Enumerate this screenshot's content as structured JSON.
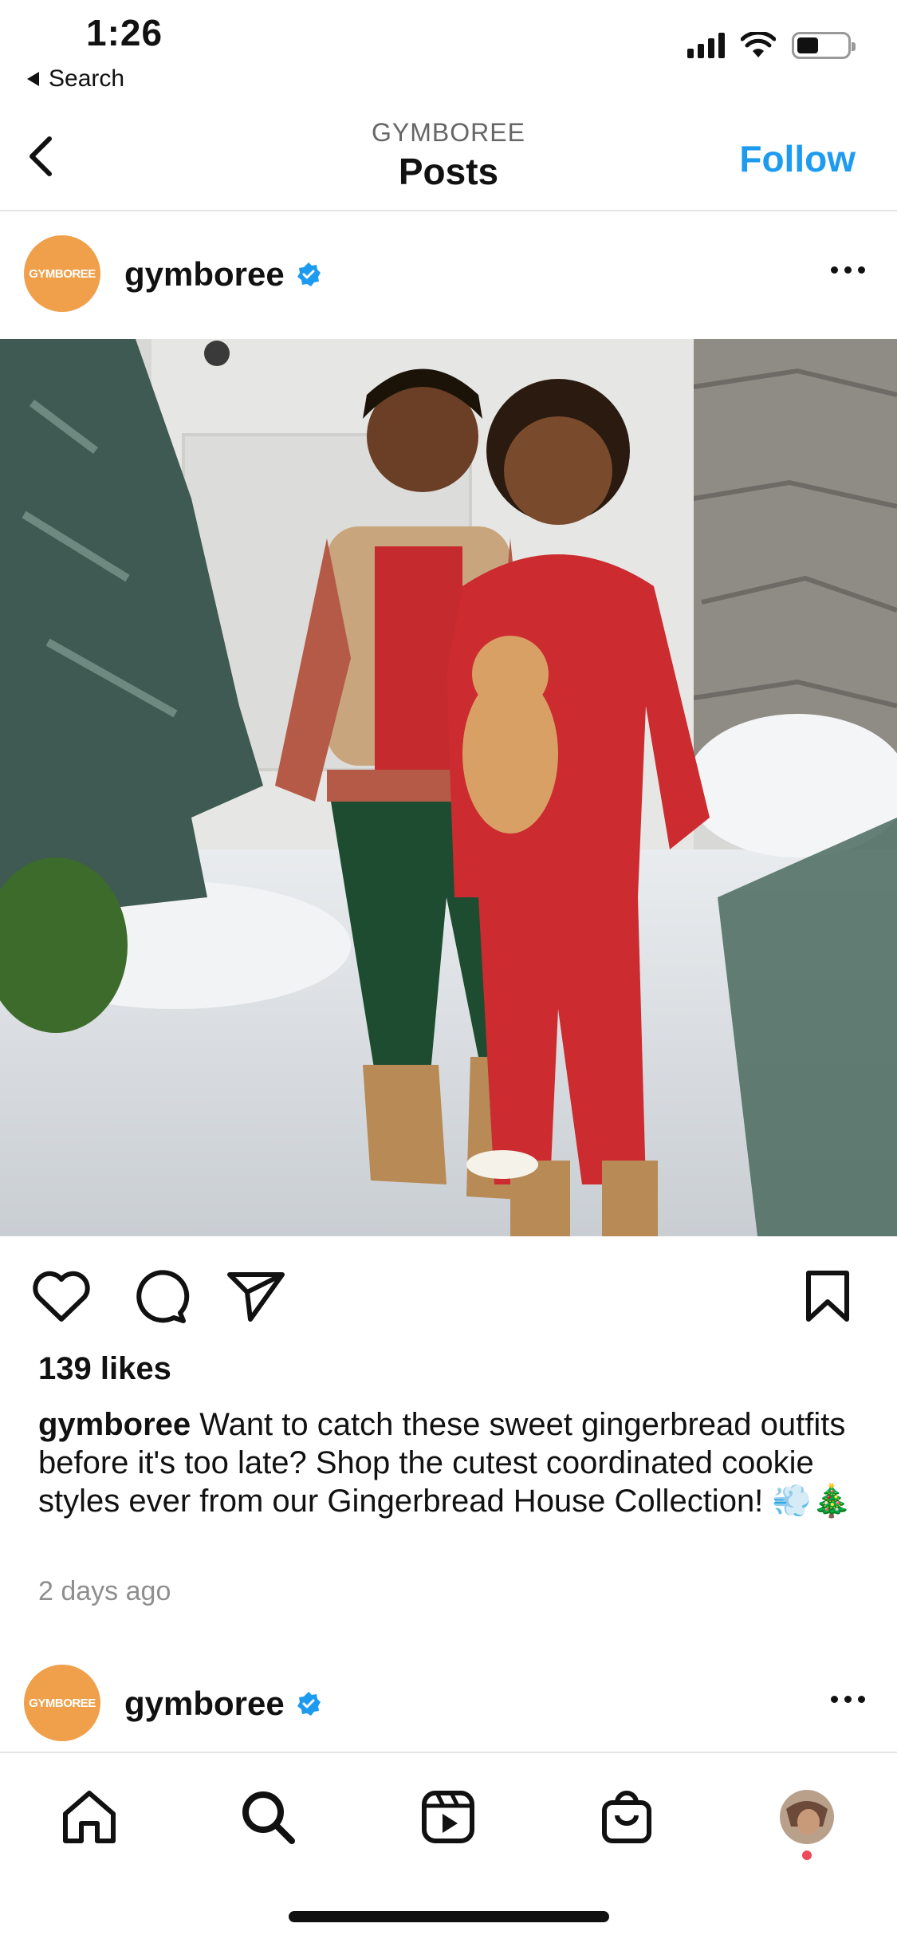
{
  "status_bar": {
    "time": "1:26",
    "back_app": "Search"
  },
  "header": {
    "subtitle": "GYMBOREE",
    "title": "Posts",
    "follow_label": "Follow"
  },
  "post": {
    "avatar_text": "GYMBOREE",
    "username": "gymboree",
    "verified": true,
    "likes": "139 likes",
    "caption_user": "gymboree",
    "caption_text": "Want to catch these sweet gingerbread outfits before it's too late? Shop the cutest coordinated cookie styles ever from our Gingerbread House Collection! 💨🎄",
    "time_ago": "2 days ago"
  },
  "next_post": {
    "avatar_text": "GYMBOREE",
    "username": "gymboree"
  },
  "colors": {
    "accent": "#1d9bf0",
    "avatar": "#f0a04b",
    "verified": "#1d9bf0",
    "notification_dot": "#ed4956"
  },
  "nav": {
    "items": [
      "home-icon",
      "search-icon",
      "reels-icon",
      "shop-icon",
      "profile-avatar"
    ]
  }
}
